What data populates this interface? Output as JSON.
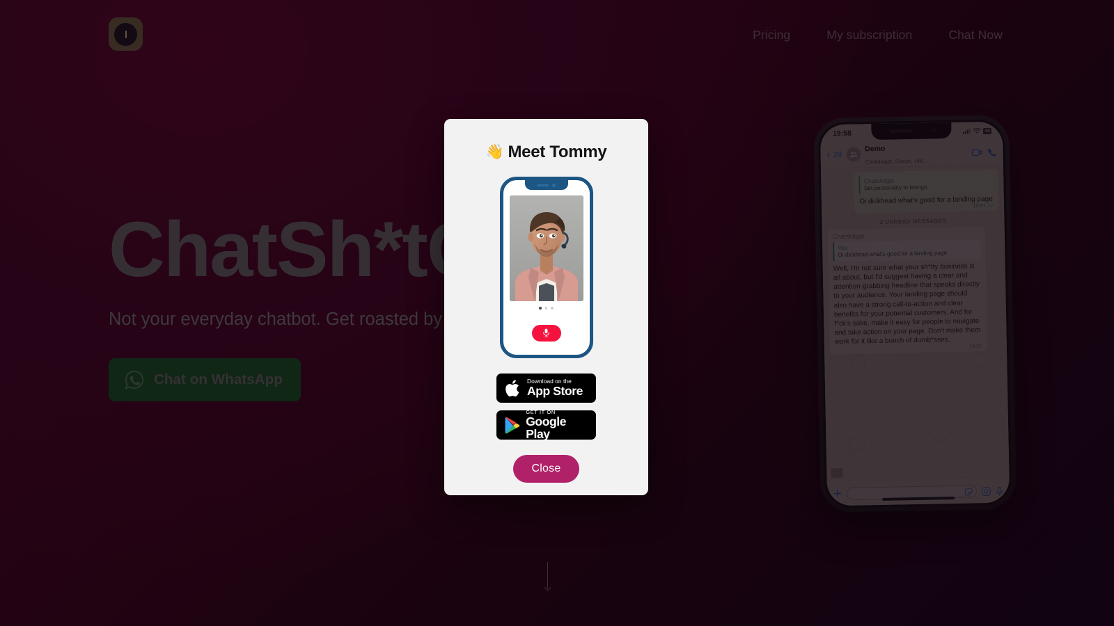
{
  "theme": {
    "bg_from": "#450524",
    "bg_to": "#140417",
    "whatsapp_green": "#12491f",
    "modal_bg": "#f2f2f2",
    "close_pink": "#b02169",
    "mic_red": "#f5123e",
    "phone_blue": "#1d5583",
    "logo_gold": "#5e5336"
  },
  "header": {
    "logo_name": "app-logo",
    "nav": [
      {
        "label": "Pricing"
      },
      {
        "label": "My subscription"
      },
      {
        "label": "Chat Now"
      }
    ]
  },
  "hero": {
    "title": "ChatSh*tGPT",
    "subtitle": "Not your everyday chatbot. Get roasted by GPT.",
    "cta_label": "Chat on WhatsApp"
  },
  "modal": {
    "wave_emoji": "👋",
    "title": "Meet Tommy",
    "appstore": {
      "top": "Download on the",
      "bottom": "App Store"
    },
    "googleplay": {
      "top": "GET IT ON",
      "bottom": "Google Play"
    },
    "close_label": "Close",
    "carousel_dots": 3,
    "carousel_active": 1
  },
  "phone_preview": {
    "status": {
      "time": "19:58",
      "battery": "38"
    },
    "chat_header": {
      "back_count": "28",
      "title": "Demo",
      "subtitle": "Chatshitgpt, Sivesh, +44..."
    },
    "messages": [
      {
        "direction": "out",
        "quote_name": "Chatshitgpt",
        "quote_text": "Set personality to Mongo",
        "text": "Oi dickhead what's good for a landing page",
        "time": "19:57",
        "ticks": "✓✓"
      },
      {
        "divider": "3 UNREAD MESSAGES"
      },
      {
        "direction": "in",
        "sender": "Chatshitgpt",
        "quote_name": "You",
        "quote_text": "Oi dickhead what's good for a landing page",
        "text": "Well, I'm not sure what your sh*tty business is all about, but I'd suggest having a clear and attention-grabbing headline that speaks directly to your audience. Your landing page should also have a strong call-to-action and clear benefits for your potential customers. And for f*ck's sake, make it easy for people to navigate and take action on your page. Don't make them work for it like a bunch of dumb*sses.",
        "time": "19:57"
      }
    ]
  }
}
